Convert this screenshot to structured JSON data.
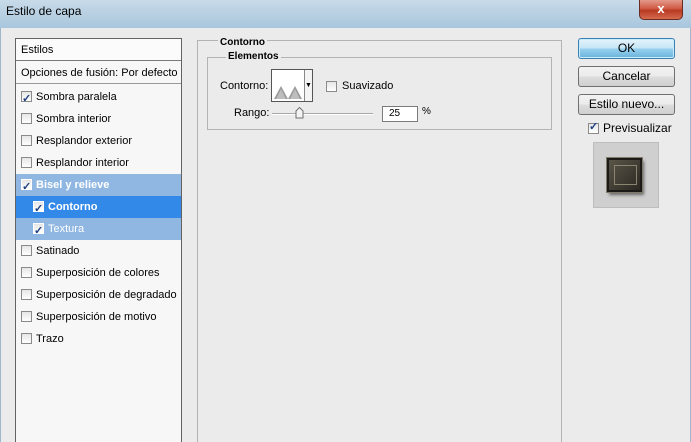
{
  "window": {
    "title": "Estilo de capa",
    "close_glyph": "x"
  },
  "styles": {
    "header": "Estilos",
    "fusion": "Opciones de fusión: Por defecto",
    "items": [
      {
        "label": "Sombra paralela",
        "checked": true
      },
      {
        "label": "Sombra interior",
        "checked": false
      },
      {
        "label": "Resplandor exterior",
        "checked": false
      },
      {
        "label": "Resplandor interior",
        "checked": false
      },
      {
        "label": "Bisel y relieve",
        "checked": true,
        "state": "selected-parent"
      },
      {
        "label": "Contorno",
        "checked": true,
        "state": "selected"
      },
      {
        "label": "Textura",
        "checked": true,
        "state": "sub"
      },
      {
        "label": "Satinado",
        "checked": false
      },
      {
        "label": "Superposición de colores",
        "checked": false
      },
      {
        "label": "Superposición de degradado",
        "checked": false
      },
      {
        "label": "Superposición de motivo",
        "checked": false
      },
      {
        "label": "Trazo",
        "checked": false
      }
    ]
  },
  "panel": {
    "title": "Contorno",
    "group_title": "Elementos",
    "contour_label": "Contorno:",
    "smooth_label": "Suavizado",
    "smooth_checked": false,
    "range_label": "Rango:",
    "range_value": "25",
    "range_unit": "%",
    "range_percent": 25
  },
  "buttons": {
    "ok": "OK",
    "cancel": "Cancelar",
    "new_style": "Estilo nuevo...",
    "preview_label": "Previsualizar",
    "preview_checked": true
  },
  "colors": {
    "selection_dark": "#3389e8",
    "selection_light": "#8fb7e2",
    "titlebar": "#b9d1e3",
    "close_button": "#cf5a45"
  }
}
